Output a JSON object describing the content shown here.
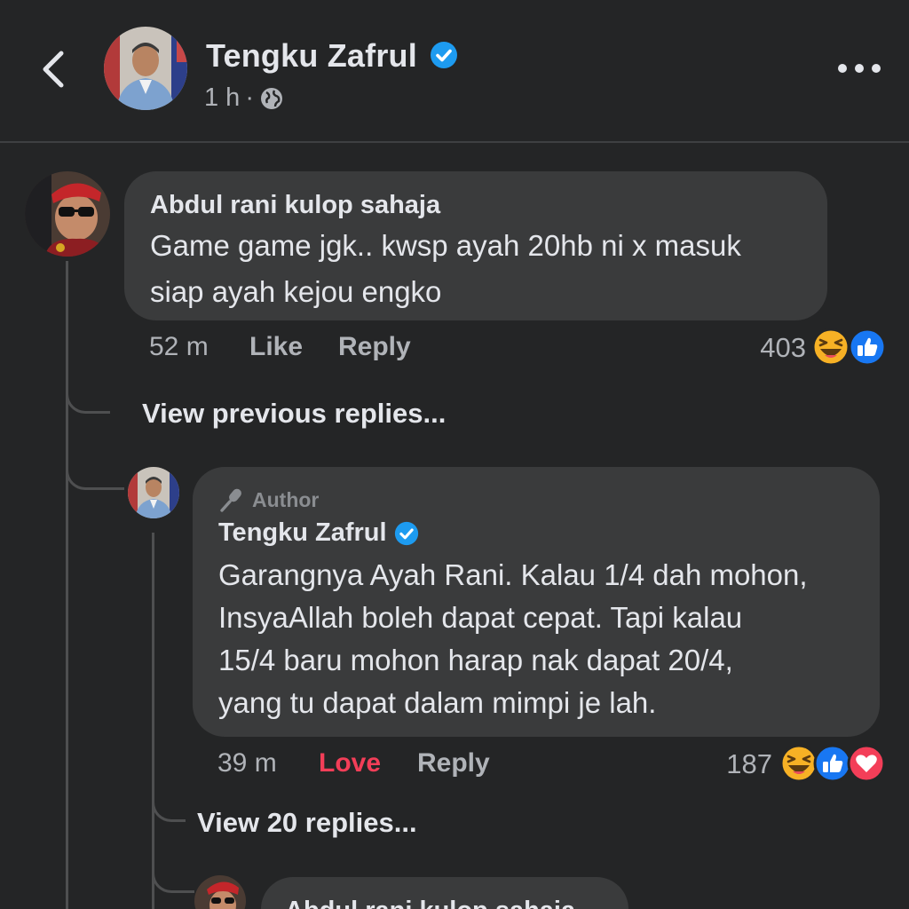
{
  "header": {
    "post_author": "Tengku Zafrul",
    "time": "1 h",
    "separator": "·"
  },
  "comments": [
    {
      "author": "Abdul rani kulop sahaja",
      "text_lines": [
        "Game game jgk.. kwsp ayah 20hb ni x masuk",
        "siap ayah kejou engko"
      ],
      "time": "52 m",
      "like_label": "Like",
      "reply_label": "Reply",
      "reaction_count": "403"
    }
  ],
  "view_previous": "View previous replies...",
  "reply": {
    "badge": "Author",
    "author": "Tengku Zafrul",
    "text_lines": [
      "Garangnya Ayah Rani. Kalau 1/4 dah mohon,",
      "InsyaAllah boleh dapat cepat. Tapi kalau",
      "15/4 baru mohon harap nak dapat 20/4,",
      "yang tu dapat dalam mimpi je lah."
    ],
    "time": "39 m",
    "love_label": "Love",
    "reply_label": "Reply",
    "reaction_count": "187"
  },
  "view_replies": "View 20 replies...",
  "next_reply_author": "Abdul rani kulop sahaja",
  "colors": {
    "background": "#242526",
    "bubble": "#3a3b3c",
    "love": "#f33e58",
    "like_blue": "#1877f2",
    "haha_yellow": "#f7b125",
    "verified_blue": "#1d9bf0"
  }
}
